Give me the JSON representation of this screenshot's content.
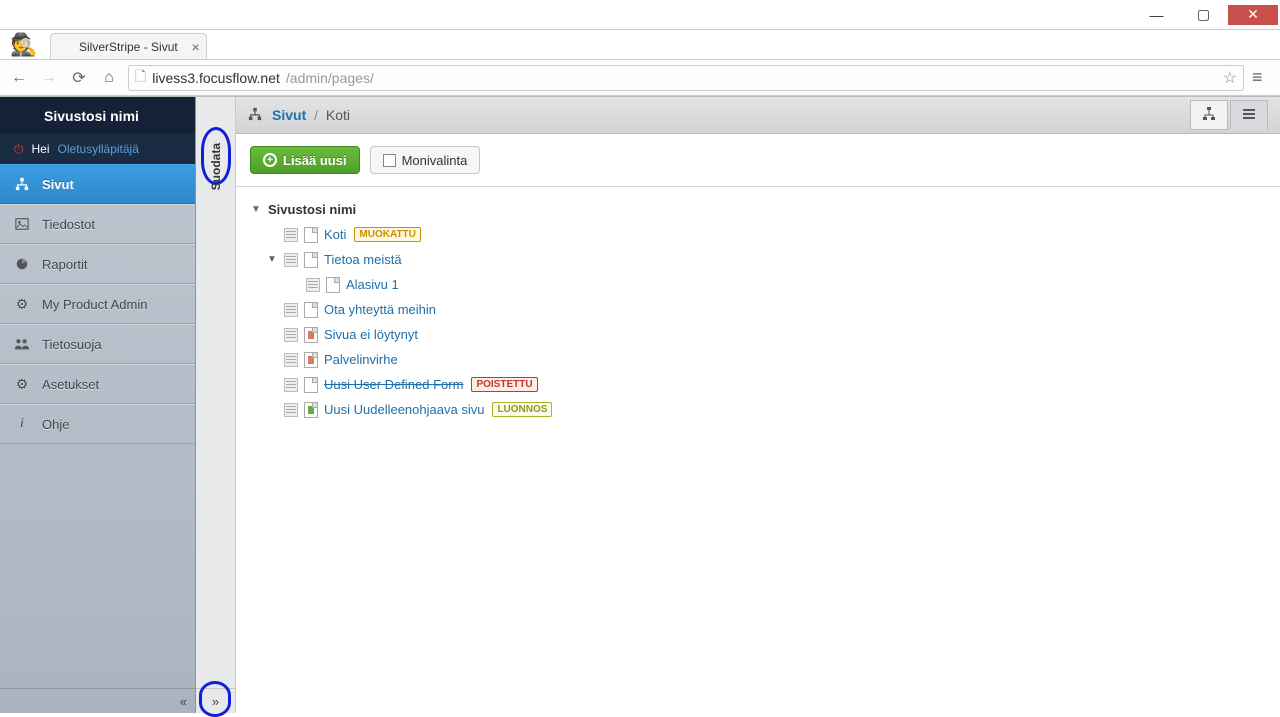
{
  "window": {
    "tab_title": "SilverStripe - Sivut"
  },
  "url": {
    "host": "livess3.focusflow.net",
    "path": "/admin/pages/"
  },
  "sidebar": {
    "site_name": "Sivustosi nimi",
    "greeting_prefix": "Hei",
    "user_name": "Oletusylläpitäjä",
    "items": [
      {
        "label": "Sivut"
      },
      {
        "label": "Tiedostot"
      },
      {
        "label": "Raportit"
      },
      {
        "label": "My Product Admin"
      },
      {
        "label": "Tietosuoja"
      },
      {
        "label": "Asetukset"
      },
      {
        "label": "Ohje"
      }
    ],
    "collapse_glyph": "«"
  },
  "filter": {
    "label": "Suodata",
    "expand_glyph": "»"
  },
  "breadcrumb": {
    "root": "Sivut",
    "current": "Koti"
  },
  "toolbar": {
    "add_label": "Lisää uusi",
    "multi_label": "Monivalinta"
  },
  "tree": {
    "root": "Sivustosi nimi",
    "nodes": [
      {
        "label": "Koti",
        "badge": "MUOKATTU",
        "badge_class": "mod",
        "icon": "page"
      },
      {
        "label": "Tietoa meistä",
        "expanded": true,
        "icon": "page"
      },
      {
        "label": "Alasivu 1",
        "level": 2,
        "icon": "page"
      },
      {
        "label": "Ota yhteyttä meihin",
        "icon": "page"
      },
      {
        "label": "Sivua ei löytynyt",
        "icon": "err"
      },
      {
        "label": "Palvelinvirhe",
        "icon": "err"
      },
      {
        "label": "Uusi User Defined Form",
        "badge": "POISTETTU",
        "badge_class": "del",
        "icon": "page",
        "deleted": true
      },
      {
        "label": "Uusi Uudelleenohjaava sivu",
        "badge": "LUONNOS",
        "badge_class": "draft",
        "icon": "redir"
      }
    ]
  }
}
